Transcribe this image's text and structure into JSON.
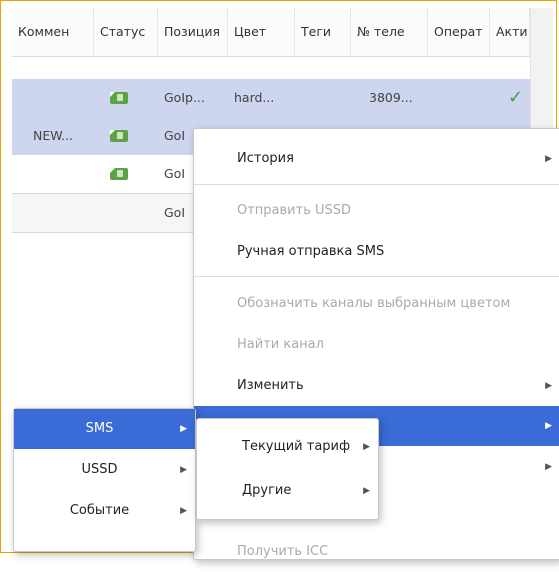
{
  "table": {
    "columns": [
      "Коммен",
      "Статус",
      "Позиция",
      "Цвет",
      "Теги",
      "№ теле",
      "Операт",
      "Акти"
    ],
    "rows": [
      {
        "comment": "",
        "position": "GoIp...",
        "color": "hard...",
        "phone": "3809...",
        "active": "✓",
        "selected": true
      },
      {
        "comment": "NEW...",
        "position": "GoI",
        "color": "",
        "phone": "",
        "active": "",
        "selected": false
      },
      {
        "comment": "",
        "position": "GoI",
        "color": "",
        "phone": "",
        "active": "",
        "selected": false
      },
      {
        "comment": "",
        "position": "GoI",
        "color": "",
        "phone": "",
        "active": "",
        "selected": false
      }
    ]
  },
  "context_menu": {
    "items": [
      {
        "label": "История",
        "disabled": false,
        "submenu": true
      },
      {
        "label": "Отправить USSD",
        "disabled": true,
        "submenu": false
      },
      {
        "label": "Ручная отправка SMS",
        "disabled": false,
        "submenu": false
      },
      {
        "label": "Обозначить каналы выбранным цветом",
        "disabled": true,
        "submenu": false
      },
      {
        "label": "Найти канал",
        "disabled": true,
        "submenu": false
      },
      {
        "label": "Изменить",
        "disabled": false,
        "submenu": true
      },
      {
        "label": "",
        "disabled": false,
        "submenu": true,
        "active": true
      },
      {
        "label": "",
        "disabled": false,
        "submenu": true
      },
      {
        "label": "Получить ICC",
        "disabled": true,
        "submenu": false
      }
    ]
  },
  "type_menu": {
    "items": [
      {
        "label": "SMS",
        "active": true
      },
      {
        "label": "USSD",
        "active": false
      },
      {
        "label": "Событие",
        "active": false
      }
    ]
  },
  "tariff_menu": {
    "items": [
      {
        "label": "Текущий тариф"
      },
      {
        "label": "Другие"
      }
    ]
  },
  "colors": {
    "accent": "#3a6bd6",
    "selection": "#cdd5ef",
    "sim": "#5ba345",
    "check": "#3aa83a",
    "frame": "#f0a000"
  }
}
